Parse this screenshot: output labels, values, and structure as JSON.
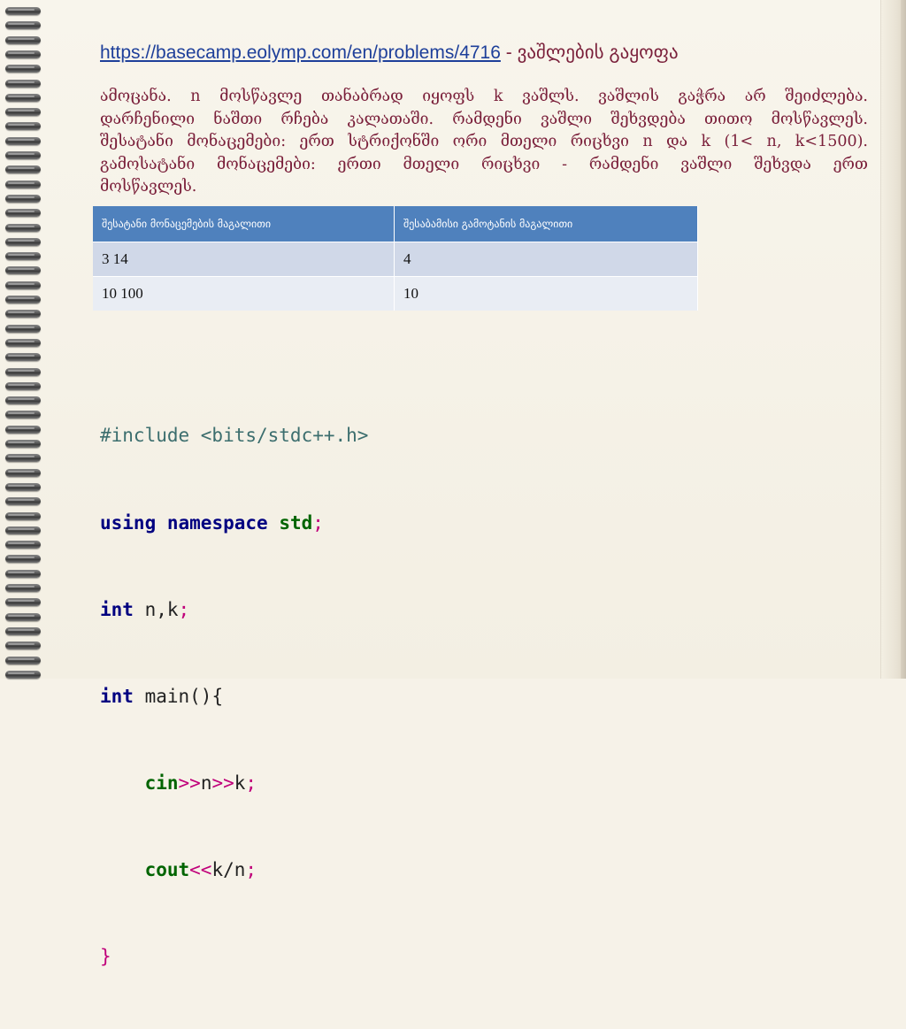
{
  "title": {
    "link": "https://basecamp.eolymp.com/en/problems/4716",
    "rest": " - ვაშლების გაყოფა"
  },
  "description": {
    "lines": [
      "ამოცანა. n მოსწავლე თანაბრად იყოფს k ვაშლს. ვაშლის გაჭრა არ შეიძლება.",
      "დარჩენილი ნაშთი რჩება კალათაში. რამდენი ვაშლი შეხვდება თითო მოსწავლეს.",
      "შესატანი მონაცემები: ერთ სტრიქონში ორი მთელი რიცხვი n და k (1< n, k<1500).",
      "გამოსატანი მონაცემები: ერთი მთელი რიცხვი - რამდენი ვაშლი შეხვდა ერთ",
      "მოსწავლეს."
    ]
  },
  "table": {
    "headers": [
      "შესატანი მონაცემების მაგალითი",
      "შესაბამისი გამოტანის მაგალითი"
    ],
    "rows": [
      [
        "3 14",
        "4"
      ],
      [
        "10 100",
        "10"
      ]
    ]
  },
  "code": {
    "l1": "#include <bits/stdc++.h>",
    "l2_using": "using",
    "l2_namespace": "namespace",
    "l2_std": "std",
    "l2_semi": ";",
    "l3_int": "int",
    "l3_vars": " n,k",
    "l3_semi": ";",
    "l4_int": "int",
    "l4_main": " main(){",
    "l5_cin": "cin",
    "l5_op1": ">>",
    "l5_n": "n",
    "l5_op2": ">>",
    "l5_k": "k",
    "l5_semi": ";",
    "l6_cout": "cout",
    "l6_op": "<<",
    "l6_expr": "k/n",
    "l6_semi": ";",
    "l7": "}"
  },
  "colors": {
    "title_link": "#1e3f9a",
    "text": "#7a1f3a",
    "table_header": "#4f81bd",
    "row_odd": "#d0d8e8",
    "row_even": "#e9edf4"
  },
  "icons": {
    "binding": "spiral-binding-rings"
  }
}
